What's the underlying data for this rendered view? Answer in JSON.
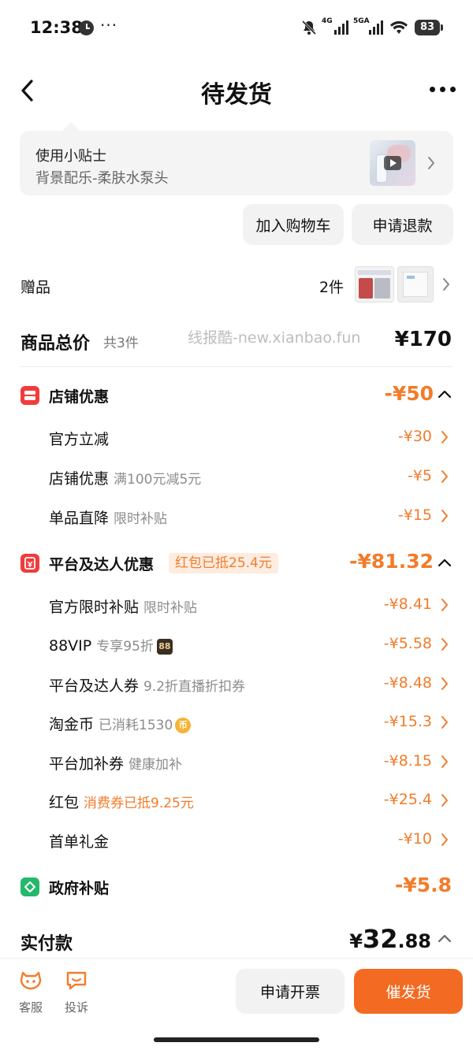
{
  "status_bar": {
    "time": "12:38",
    "dots": "···",
    "network_1": "4G",
    "network_2": "5GA",
    "battery": "83"
  },
  "header": {
    "title": "待发货"
  },
  "tips": {
    "title": "使用小贴士",
    "subtitle": "背景配乐-柔肤水泵头"
  },
  "actions": {
    "add_to_cart": "加入购物车",
    "refund": "申请退款"
  },
  "gift": {
    "label": "赠品",
    "count": "2件"
  },
  "total": {
    "label": "商品总价",
    "count": "共3件",
    "value": "¥170",
    "watermark": "线报酷-new.xianbao.fun"
  },
  "shop_discount": {
    "title": "店铺优惠",
    "value": "-¥50",
    "items": [
      {
        "label": "官方立减",
        "sub": "",
        "value": "-¥30"
      },
      {
        "label": "店铺优惠",
        "sub": "满100元减5元",
        "value": "-¥5"
      },
      {
        "label": "单品直降",
        "sub": "限时补贴",
        "value": "-¥15"
      }
    ]
  },
  "platform_discount": {
    "title": "平台及达人优惠",
    "tag": "红包已抵25.4元",
    "value": "-¥81.32",
    "items": [
      {
        "label": "官方限时补贴",
        "sub": "限时补贴",
        "value": "-¥8.41"
      },
      {
        "label": "88VIP",
        "sub": "专享95折",
        "badge": "88",
        "value": "-¥5.58"
      },
      {
        "label": "平台及达人券",
        "sub": "9.2折直播折扣券",
        "value": "-¥8.48"
      },
      {
        "label": "淘金币",
        "sub": "已消耗1530",
        "coin": "币",
        "value": "-¥15.3"
      },
      {
        "label": "平台加补券",
        "sub": "健康加补",
        "value": "-¥8.15"
      },
      {
        "label": "红包",
        "sub": "消费券已抵9.25元",
        "value": "-¥25.4"
      },
      {
        "label": "首单礼金",
        "sub": "",
        "value": "-¥10"
      }
    ]
  },
  "gov_subsidy": {
    "title": "政府补贴",
    "value": "-¥5.8"
  },
  "paid": {
    "label": "实付款",
    "currency": "¥",
    "integer": "32",
    "decimal": ".88"
  },
  "bottom": {
    "service": "客服",
    "complain": "投诉",
    "invoice": "申请开票",
    "urge": "催发货"
  },
  "colors": {
    "accent": "#f27c2b",
    "primary_button": "#f36a22",
    "shop_icon": "#f23b3b",
    "gov_icon": "#25b86b"
  }
}
